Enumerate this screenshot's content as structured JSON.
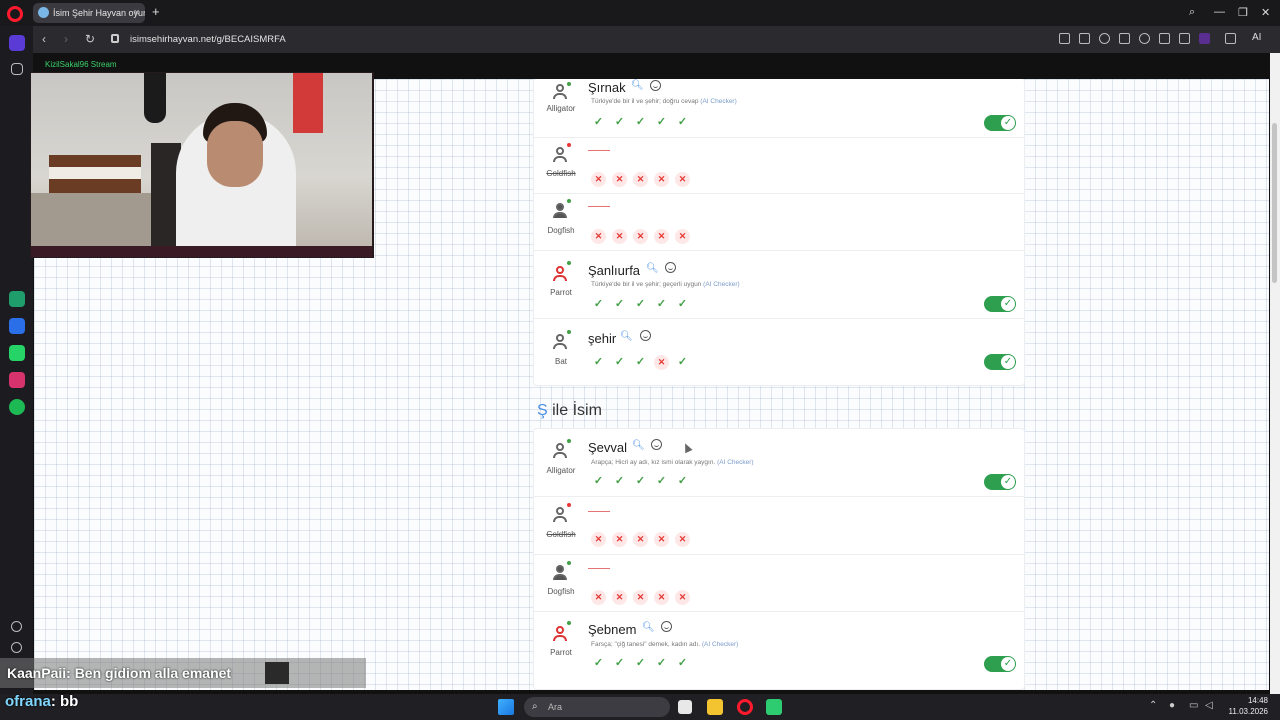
{
  "browser": {
    "tab_title": "İsim Şehir Hayvan oyunu",
    "url": "isimsehirhayvan.net/g/BECAISMRFA",
    "ai_label": "AI",
    "accent": "#ff1b2d"
  },
  "stream": {
    "label": "KizilSakal96 Stream",
    "chat": [
      {
        "user": "KaanPaii",
        "text": ": Ben gidiom alla emanet"
      },
      {
        "user": "ofrana",
        "text": ": bb"
      }
    ]
  },
  "previous_section": {
    "rows": [
      {
        "player": "Alligator",
        "answer": "Şırnak",
        "subtitle": "Türkiye'de bir il ve şehir; doğru cevap",
        "ai_note": "(AI Checker)",
        "marks": [
          "ok",
          "ok",
          "ok",
          "ok",
          "ok"
        ],
        "accepted": true,
        "player_struck": false,
        "avatar": "default"
      },
      {
        "player": "Goldfish",
        "answer": "",
        "subtitle": "",
        "ai_note": "",
        "marks": [
          "no",
          "no",
          "no",
          "no",
          "no"
        ],
        "accepted": false,
        "player_struck": true,
        "avatar": "default"
      },
      {
        "player": "Dogfish",
        "answer": "",
        "subtitle": "",
        "ai_note": "",
        "marks": [
          "no",
          "no",
          "no",
          "no",
          "no"
        ],
        "accepted": false,
        "player_struck": false,
        "avatar": "dark"
      },
      {
        "player": "Parrot",
        "answer": "Şanlıurfa",
        "subtitle": "Türkiye'de bir il ve şehir; geçerli uygun",
        "ai_note": "(AI Checker)",
        "marks": [
          "ok",
          "ok",
          "ok",
          "ok",
          "ok"
        ],
        "accepted": true,
        "player_struck": false,
        "avatar": "red"
      },
      {
        "player": "Bat",
        "answer": "şehir",
        "subtitle": "",
        "ai_note": "",
        "marks": [
          "ok",
          "ok",
          "ok",
          "no",
          "ok"
        ],
        "accepted": true,
        "player_struck": false,
        "avatar": "default"
      }
    ]
  },
  "section": {
    "letter": "Ş",
    "title": "ile İsim",
    "rows": [
      {
        "player": "Alligator",
        "answer": "Şevval",
        "subtitle": "Arapça; Hicri ay adı, kız ismi olarak yaygın.",
        "ai_note": "(AI Checker)",
        "marks": [
          "ok",
          "ok",
          "ok",
          "ok",
          "ok"
        ],
        "accepted": true,
        "player_struck": false,
        "avatar": "default"
      },
      {
        "player": "Goldfish",
        "answer": "",
        "subtitle": "",
        "ai_note": "",
        "marks": [
          "no",
          "no",
          "no",
          "no",
          "no"
        ],
        "accepted": false,
        "player_struck": true,
        "avatar": "default"
      },
      {
        "player": "Dogfish",
        "answer": "",
        "subtitle": "",
        "ai_note": "",
        "marks": [
          "no",
          "no",
          "no",
          "no",
          "no"
        ],
        "accepted": false,
        "player_struck": false,
        "avatar": "dark"
      },
      {
        "player": "Parrot",
        "answer": "Şebnem",
        "subtitle": "Farsça; \"çiğ tanesi\" demek, kadın adı.",
        "ai_note": "(AI Checker)",
        "marks": [
          "ok",
          "ok",
          "ok",
          "ok",
          "ok"
        ],
        "accepted": true,
        "player_struck": false,
        "avatar": "red"
      }
    ]
  },
  "taskbar": {
    "search_placeholder": "Ara",
    "time": "14:48",
    "date": "11.03.2026"
  }
}
